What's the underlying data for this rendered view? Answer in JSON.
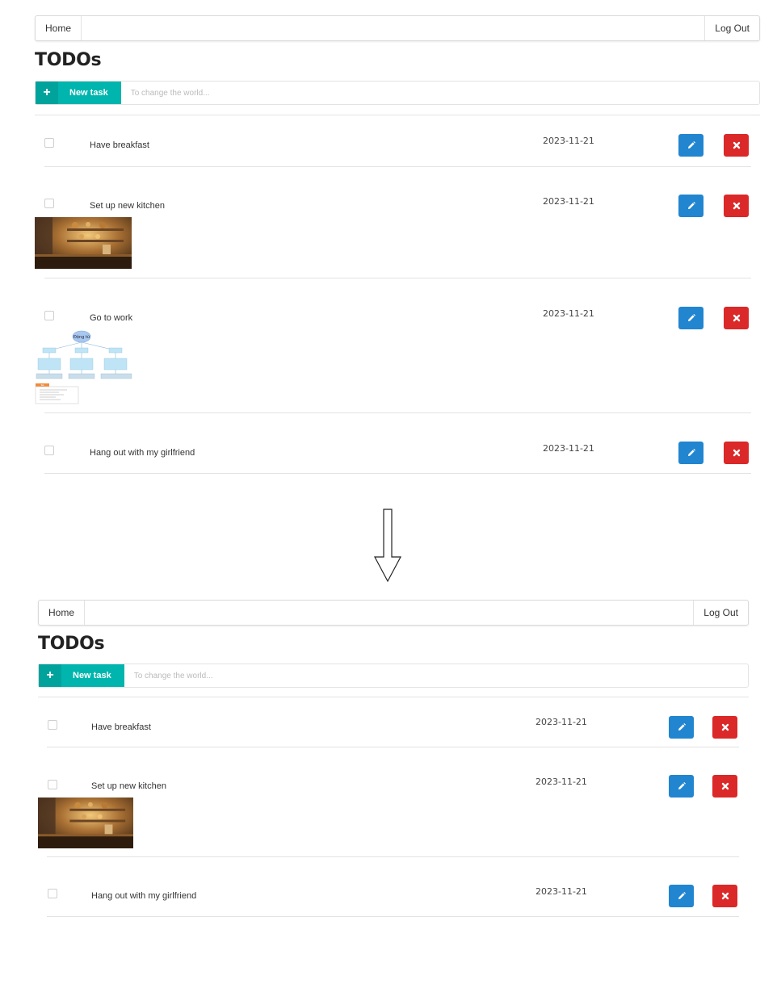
{
  "navbar": {
    "home_label": "Home",
    "logout_label": "Log Out"
  },
  "page_title": "TODOs",
  "new_task": {
    "button_label": "New task",
    "plus_icon": "+",
    "placeholder": "To change the world..."
  },
  "before": {
    "tasks": [
      {
        "text": "Have breakfast",
        "date": "2023-11-21",
        "attachment": "none"
      },
      {
        "text": "Set up new kitchen",
        "date": "2023-11-21",
        "attachment": "kitchen-photo"
      },
      {
        "text": "Go to work",
        "date": "2023-11-21",
        "attachment": "diagram",
        "attachment_root": "Động từ",
        "attachment_tab": "Tab"
      },
      {
        "text": "Hang out with my girlfriend",
        "date": "2023-11-21",
        "attachment": "none"
      }
    ]
  },
  "after": {
    "tasks": [
      {
        "text": "Have breakfast",
        "date": "2023-11-21",
        "attachment": "none"
      },
      {
        "text": "Set up new kitchen",
        "date": "2023-11-21",
        "attachment": "kitchen-photo"
      },
      {
        "text": "Hang out with my girlfriend",
        "date": "2023-11-21",
        "attachment": "none"
      }
    ]
  },
  "icons": {
    "edit": "pencil-icon",
    "delete": "close-icon",
    "transition": "arrow-down-icon"
  },
  "colors": {
    "teal": "#00b5ad",
    "blue": "#2185d0",
    "red": "#db2828"
  }
}
